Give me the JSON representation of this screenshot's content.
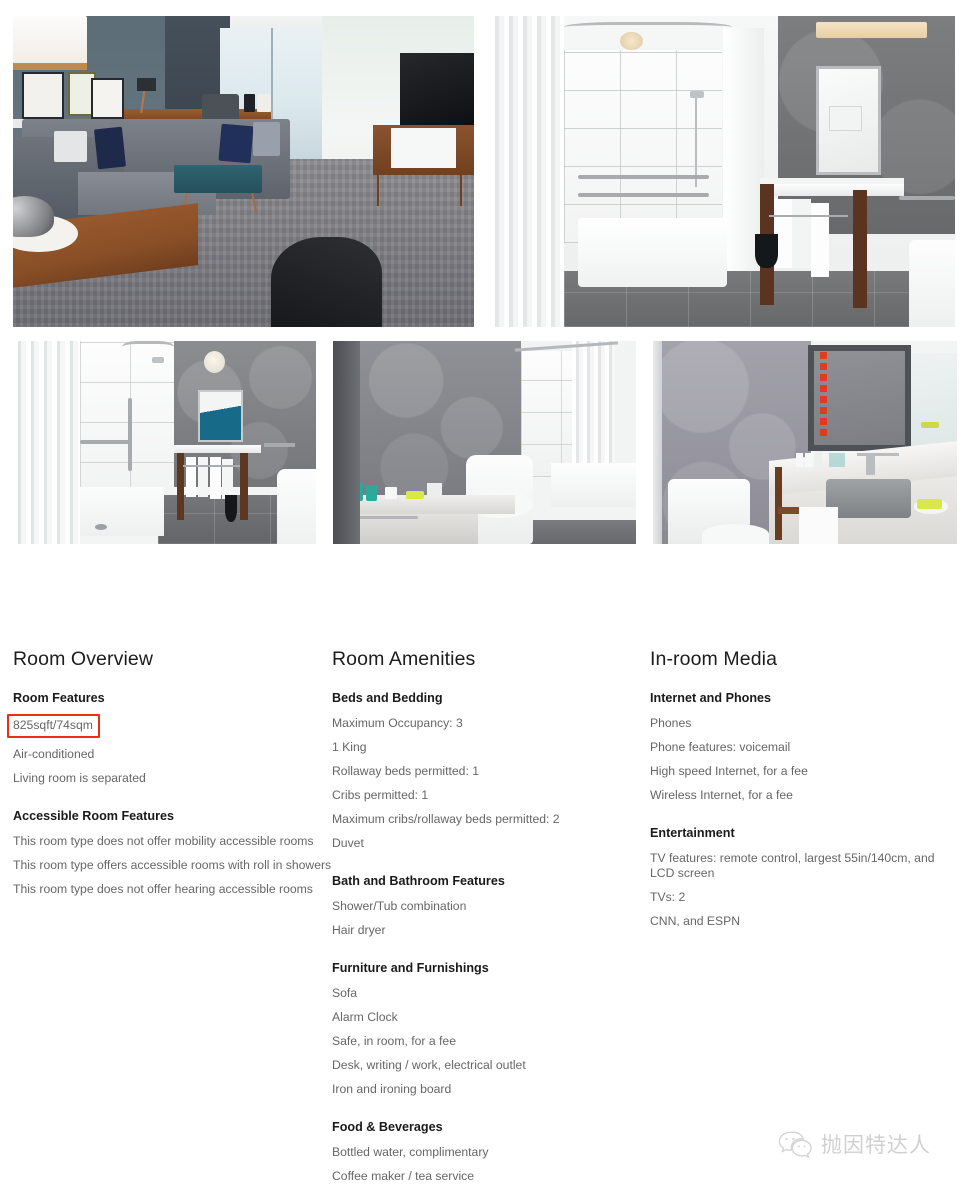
{
  "gallery": {
    "photos": [
      {
        "name": "living-room-photo",
        "alt": "Hotel suite living room with sectional sofa, teal ottoman, TV on wood credenza and floor-to-ceiling window"
      },
      {
        "name": "accessible-tub-bathroom-photo",
        "alt": "Accessible bathroom with bathtub, grab bars, shower curtain and dark wood vanity"
      },
      {
        "name": "roll-in-shower-photo",
        "alt": "Roll in shower with grab bars, shower curtain and vanity with mirror"
      },
      {
        "name": "tub-bathroom-photo",
        "alt": "Bathroom with toilet, shower tub combination and grey patterned wallpaper"
      },
      {
        "name": "vanity-sink-photo",
        "alt": "Bathroom vanity with marble counter, undermount sink and large mirror"
      }
    ]
  },
  "columns": [
    {
      "title": "Room Overview",
      "groups": [
        {
          "title": "Room Features",
          "items": [
            "825sqft/74sqm",
            "Air-conditioned",
            "Living room is separated"
          ],
          "highlight_index": 0
        },
        {
          "title": "Accessible Room Features",
          "items": [
            "This room type does not offer mobility accessible rooms",
            "This room type offers accessible rooms with roll in showers",
            "This room type does not offer hearing accessible rooms"
          ]
        }
      ]
    },
    {
      "title": "Room Amenities",
      "groups": [
        {
          "title": "Beds and Bedding",
          "items": [
            "Maximum Occupancy: 3",
            "1 King",
            "Rollaway beds permitted: 1",
            "Cribs permitted: 1",
            "Maximum cribs/rollaway beds permitted: 2",
            "Duvet"
          ]
        },
        {
          "title": "Bath and Bathroom Features",
          "items": [
            "Shower/Tub combination",
            "Hair dryer"
          ]
        },
        {
          "title": "Furniture and Furnishings",
          "items": [
            "Sofa",
            "Alarm Clock",
            "Safe, in room, for a fee",
            "Desk, writing / work, electrical outlet",
            "Iron and ironing board"
          ]
        },
        {
          "title": "Food & Beverages",
          "items": [
            "Bottled water, complimentary",
            "Coffee maker / tea service"
          ]
        }
      ]
    },
    {
      "title": "In-room Media",
      "groups": [
        {
          "title": "Internet and Phones",
          "items": [
            "Phones",
            "Phone features: voicemail",
            "High speed Internet, for a fee",
            "Wireless Internet, for a fee"
          ]
        },
        {
          "title": "Entertainment",
          "items": [
            "TV features: remote control, largest 55in/140cm, and LCD screen",
            "TVs: 2",
            "CNN, and ESPN"
          ]
        }
      ]
    }
  ],
  "watermark": {
    "icon": "wechat-icon",
    "text": "抛因特达人"
  },
  "colors": {
    "highlight_border": "#ee2d17",
    "heading": "#1d1d1d",
    "body_text": "#666666",
    "watermark_text": "#b4b4b4"
  }
}
